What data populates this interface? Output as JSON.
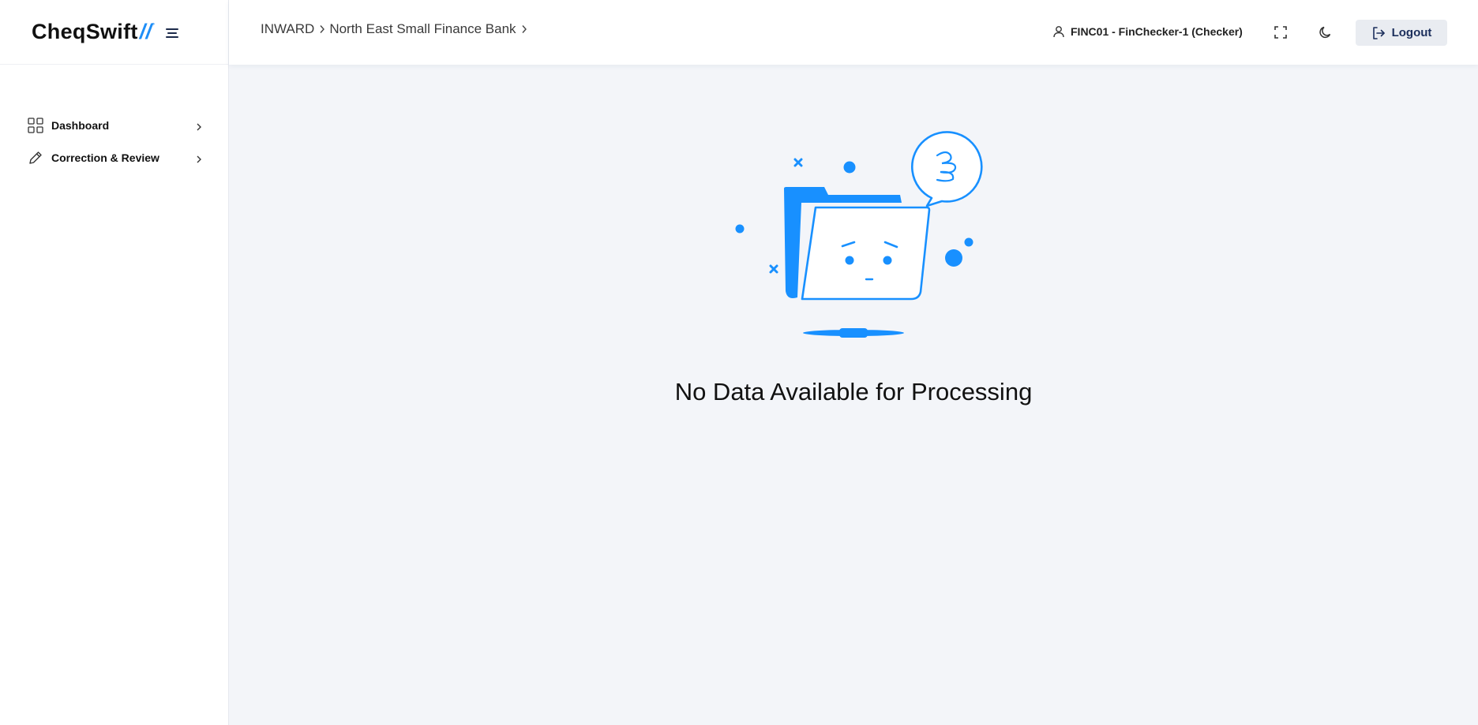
{
  "app": {
    "logo_text": "CheqSwift",
    "logo_mark": "//",
    "logo_dot": "°"
  },
  "sidebar": {
    "items": [
      {
        "label": "Dashboard",
        "icon": "grid-icon"
      },
      {
        "label": "Correction & Review",
        "icon": "pencil-icon"
      }
    ]
  },
  "header": {
    "breadcrumb": [
      "INWARD",
      "North East Small Finance Bank"
    ],
    "user_label": "FINC01 - FinChecker-1 (Checker)",
    "logout_label": "Logout"
  },
  "main": {
    "empty_message": "No Data Available for Processing"
  },
  "colors": {
    "accent": "#1e8ef7",
    "illustration": "#1890ff",
    "background": "#f3f5f9"
  }
}
